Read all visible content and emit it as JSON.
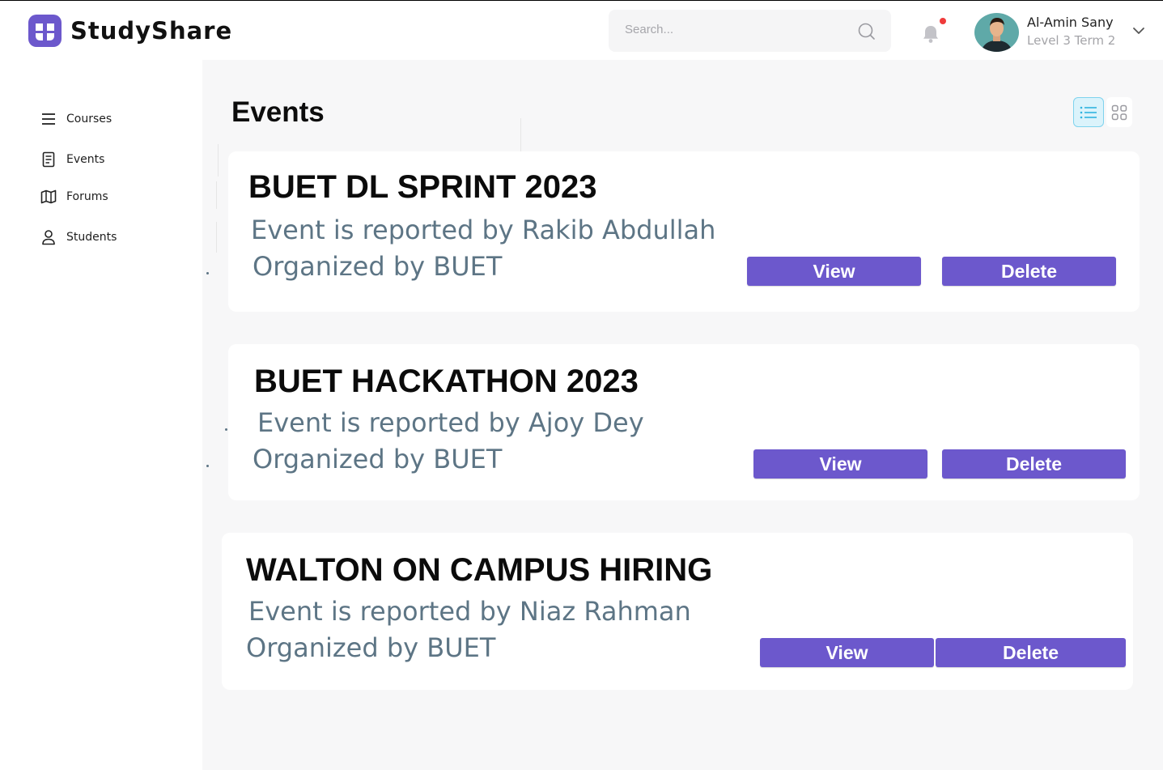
{
  "app": {
    "name": "StudyShare",
    "brand_color": "#6c58cc"
  },
  "header": {
    "search": {
      "placeholder": "Search..."
    },
    "notifications": {
      "icon": "bell-icon",
      "has_unread": true
    },
    "user": {
      "name": "Al-Amin Sany",
      "level": "Level 3 Term 2"
    }
  },
  "sidebar": {
    "items": [
      {
        "label": "Courses",
        "icon": "menu-icon"
      },
      {
        "label": "Events",
        "icon": "document-icon"
      },
      {
        "label": "Forums",
        "icon": "map-icon"
      },
      {
        "label": "Students",
        "icon": "user-icon"
      }
    ]
  },
  "main": {
    "title": "Events",
    "view_mode": "list",
    "events": [
      {
        "title": "BUET DL SPRINT 2023",
        "reporter": "Event is reported by Rakib Abdullah",
        "organizer": "Organized by BUET",
        "view_label": "View",
        "delete_label": "Delete"
      },
      {
        "title": "BUET HACKATHON 2023",
        "reporter": "Event is reported by Ajoy Dey",
        "organizer": "Organized by BUET",
        "view_label": "View",
        "delete_label": "Delete"
      },
      {
        "title": "WALTON ON CAMPUS HIRING",
        "reporter": "Event is reported by Niaz Rahman",
        "organizer": "Organized by BUET",
        "view_label": "View",
        "delete_label": "Delete"
      }
    ]
  }
}
